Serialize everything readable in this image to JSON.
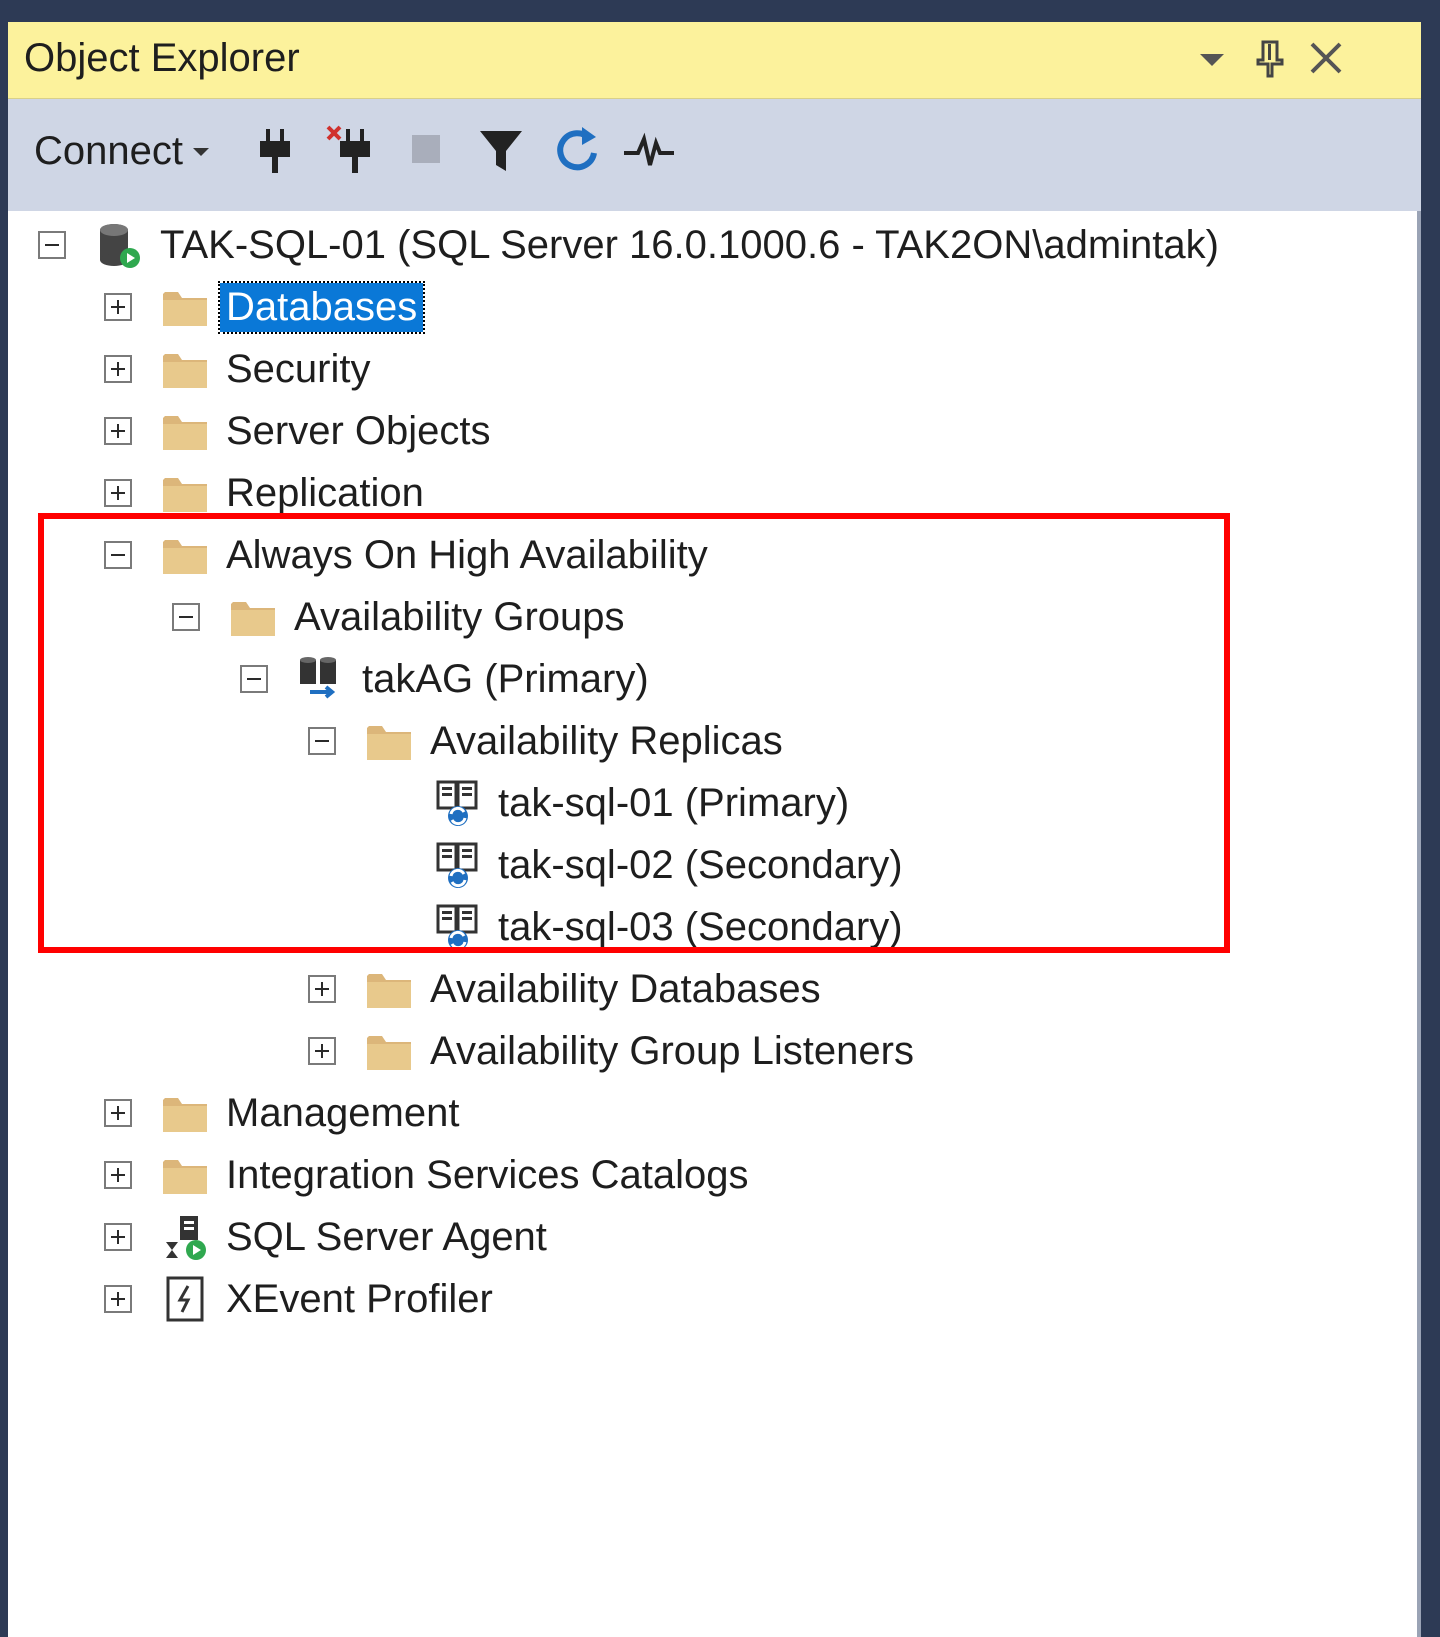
{
  "window": {
    "title": "Object Explorer"
  },
  "titlebar_buttons": [
    {
      "icon": "dropdown-arrow-icon"
    },
    {
      "icon": "pin-icon"
    },
    {
      "icon": "close-icon"
    }
  ],
  "toolbar": {
    "connect_label": "Connect",
    "tools": [
      "connect-plug-icon",
      "disconnect-plug-icon",
      "stop-icon",
      "filter-icon",
      "refresh-icon",
      "activity-monitor-icon"
    ]
  },
  "tree": {
    "server": {
      "label": "TAK-SQL-01 (SQL Server 16.0.1000.6 - TAK2ON\\admintak)",
      "expanded": true
    },
    "databases": {
      "label": "Databases",
      "selected": true
    },
    "security": {
      "label": "Security"
    },
    "server_objects": {
      "label": "Server Objects"
    },
    "replication": {
      "label": "Replication"
    },
    "always_on": {
      "label": "Always On High Availability",
      "expanded": true
    },
    "availability_groups": {
      "label": "Availability Groups",
      "expanded": true
    },
    "takag": {
      "label": "takAG (Primary)",
      "expanded": true
    },
    "availability_replicas": {
      "label": "Availability Replicas",
      "expanded": true
    },
    "replicas": [
      {
        "label": "tak-sql-01 (Primary)"
      },
      {
        "label": "tak-sql-02 (Secondary)"
      },
      {
        "label": "tak-sql-03 (Secondary)"
      }
    ],
    "availability_databases": {
      "label": "Availability Databases"
    },
    "ag_listeners": {
      "label": "Availability Group Listeners"
    },
    "management": {
      "label": "Management"
    },
    "integration_services": {
      "label": "Integration Services Catalogs"
    },
    "sql_agent": {
      "label": "SQL Server Agent"
    },
    "xevent": {
      "label": "XEvent Profiler"
    }
  },
  "colors": {
    "titlebar_bg": "#fcf29c",
    "toolbar_bg": "#cfd6e5",
    "selection_bg": "#0a78d7",
    "highlight_border": "#ff0000",
    "folder": "#dcb67a"
  }
}
